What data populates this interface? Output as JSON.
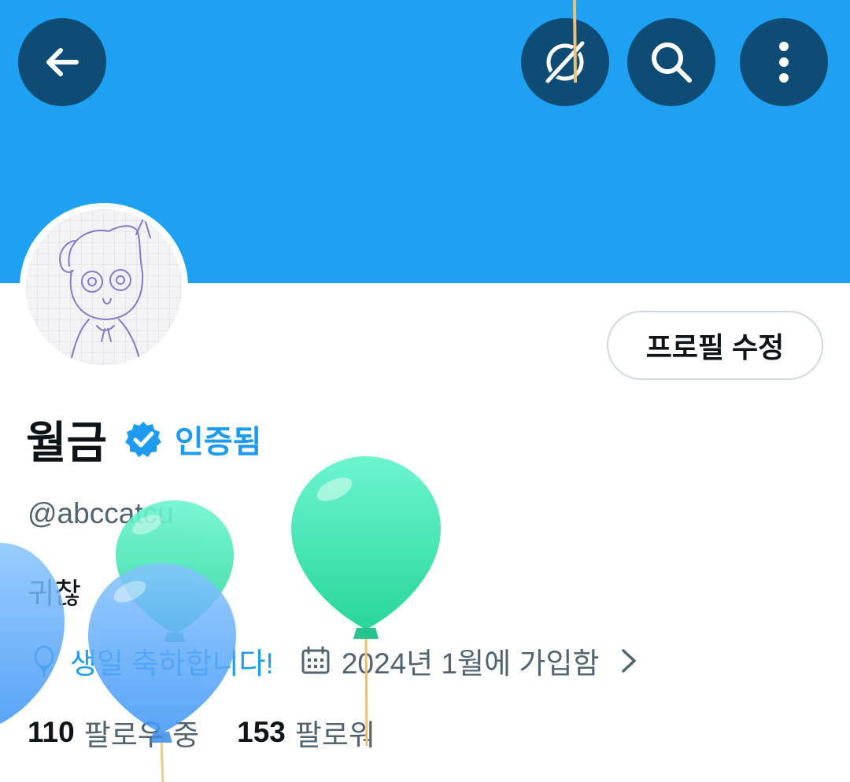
{
  "header": {
    "back_icon": "arrow-left-icon",
    "grok_icon": "grok-icon",
    "search_icon": "search-icon",
    "more_icon": "more-vertical-icon",
    "banner_color": "#1da1f2",
    "button_color": "#0f4c75"
  },
  "profile": {
    "edit_button_label": "프로필 수정",
    "display_name": "월금",
    "verified_label": "인증됨",
    "handle": "@abccatcu",
    "bio": "귀찮",
    "birthday_text": "생일 축하합니다!",
    "joined_text": "2024년 1월에 가입함",
    "following_count": "110",
    "following_label": "팔로우 중",
    "followers_count": "153",
    "followers_label": "팔로워"
  },
  "colors": {
    "accent": "#1d9bf0",
    "secondary_text": "#536471",
    "balloon_green": "#3ee6b0",
    "balloon_blue": "#4da6ff"
  }
}
